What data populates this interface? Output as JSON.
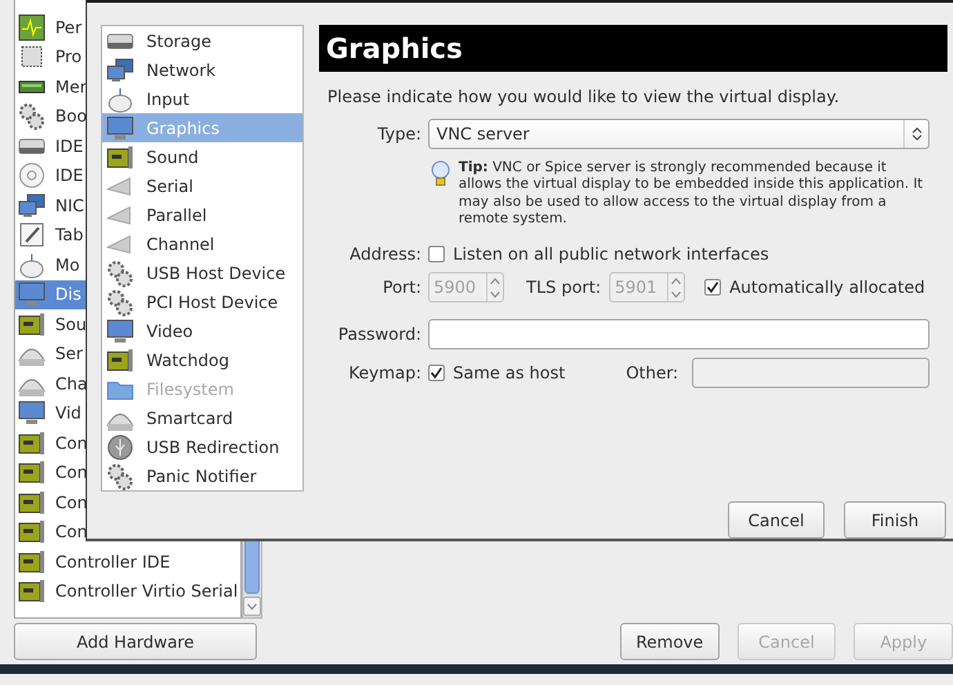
{
  "hardware_window": {
    "hardware_list": [
      {
        "label": "Per",
        "selected": false
      },
      {
        "label": "Pro",
        "selected": false
      },
      {
        "label": "Mer",
        "selected": false
      },
      {
        "label": "Boo",
        "selected": false
      },
      {
        "label": "IDE",
        "selected": false
      },
      {
        "label": "IDE",
        "selected": false
      },
      {
        "label": "NIC",
        "selected": false
      },
      {
        "label": "Tab",
        "selected": false
      },
      {
        "label": "Mo",
        "selected": false
      },
      {
        "label": "Dis",
        "selected": true
      },
      {
        "label": "Sou",
        "selected": false
      },
      {
        "label": "Ser",
        "selected": false
      },
      {
        "label": "Cha",
        "selected": false
      },
      {
        "label": "Vid",
        "selected": false
      },
      {
        "label": "Con",
        "selected": false
      },
      {
        "label": "Con",
        "selected": false
      },
      {
        "label": "Con",
        "selected": false
      },
      {
        "label": "Con",
        "selected": false
      },
      {
        "label": "Controller IDE",
        "selected": false
      },
      {
        "label": "Controller Virtio Serial",
        "selected": false
      }
    ],
    "add_button": {
      "label": "Add Hardware",
      "disabled": false
    },
    "buttons": [
      {
        "label": "Remove",
        "disabled": false
      },
      {
        "label": "Cancel",
        "disabled": true
      },
      {
        "label": "Apply",
        "disabled": true
      }
    ]
  },
  "dialog": {
    "device_types": [
      {
        "label": "Storage",
        "selected": false,
        "disabled": false
      },
      {
        "label": "Network",
        "selected": false,
        "disabled": false
      },
      {
        "label": "Input",
        "selected": false,
        "disabled": false
      },
      {
        "label": "Graphics",
        "selected": true,
        "disabled": false
      },
      {
        "label": "Sound",
        "selected": false,
        "disabled": false
      },
      {
        "label": "Serial",
        "selected": false,
        "disabled": false
      },
      {
        "label": "Parallel",
        "selected": false,
        "disabled": false
      },
      {
        "label": "Channel",
        "selected": false,
        "disabled": false
      },
      {
        "label": "USB Host Device",
        "selected": false,
        "disabled": false
      },
      {
        "label": "PCI Host Device",
        "selected": false,
        "disabled": false
      },
      {
        "label": "Video",
        "selected": false,
        "disabled": false
      },
      {
        "label": "Watchdog",
        "selected": false,
        "disabled": false
      },
      {
        "label": "Filesystem",
        "selected": false,
        "disabled": true
      },
      {
        "label": "Smartcard",
        "selected": false,
        "disabled": false
      },
      {
        "label": "USB Redirection",
        "selected": false,
        "disabled": false
      },
      {
        "label": "Panic Notifier",
        "selected": false,
        "disabled": false
      }
    ],
    "header": "Graphics",
    "intro": "Please indicate how you would like to view the virtual display.",
    "type": {
      "label": "Type:",
      "value": "VNC server"
    },
    "tip": "**Tip:** VNC or Spice server is strongly recommended because it allows the virtual display to be embedded inside this application. It may also be used to allow access to the virtual display from a remote system.",
    "address": {
      "label": "Address:",
      "option": "Listen on all public network interfaces",
      "checked": false
    },
    "port": {
      "label": "Port:",
      "value": "5900",
      "disabled": true
    },
    "tls_port": {
      "label": "TLS port:",
      "value": "5901",
      "disabled": true
    },
    "auto_allocate": {
      "label": "Automatically allocated",
      "checked": true
    },
    "password": {
      "label": "Password:"
    },
    "keymap": {
      "label": "Keymap:",
      "option": "Same as host",
      "checked": true
    },
    "other": {
      "label": "Other:",
      "disabled": true
    },
    "buttons": [
      {
        "label": "Cancel"
      },
      {
        "label": "Finish"
      }
    ]
  }
}
